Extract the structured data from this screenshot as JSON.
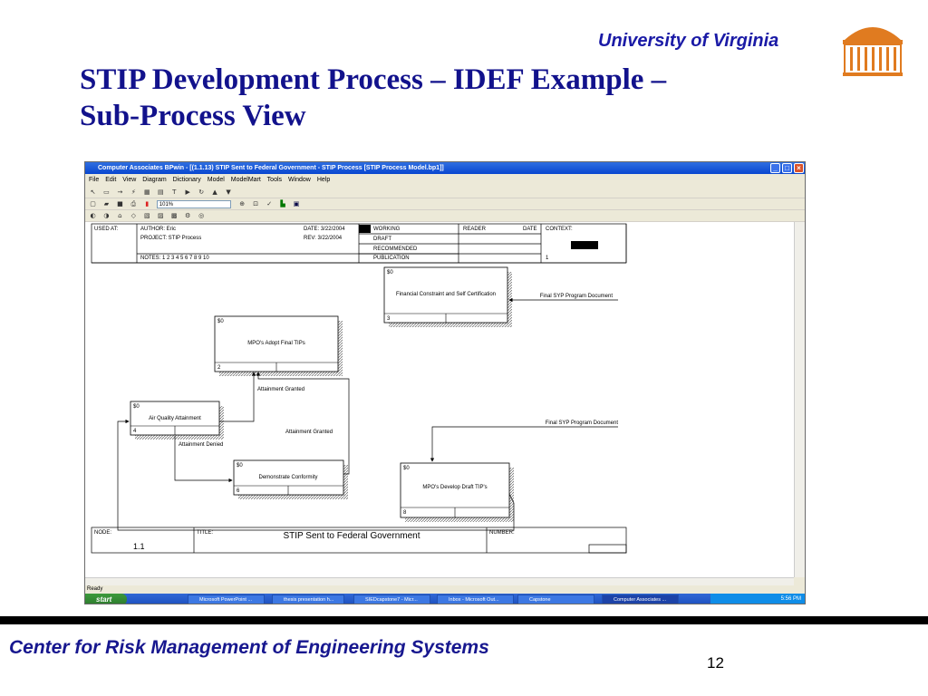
{
  "header": {
    "university": "University of Virginia",
    "title_line1": "STIP Development Process – IDEF Example –",
    "title_line2": "Sub-Process View",
    "logo_icon": "rotunda-logo-icon"
  },
  "footer": {
    "center": "Center for Risk Management of Engineering Systems",
    "page_number": "12"
  },
  "app": {
    "window_title": "Computer Associates BPwin - [(1.1.13) STIP Sent to Federal Government - STIP Process  [STIP Process Model.bp1]]",
    "menu": [
      "File",
      "Edit",
      "View",
      "Diagram",
      "Dictionary",
      "Model",
      "ModelMart",
      "Tools",
      "Window",
      "Help"
    ],
    "zoom": "101%",
    "status": "Ready"
  },
  "diagram": {
    "header": {
      "used_at": "USED AT:",
      "author": "AUTHOR:  Eric",
      "project": "PROJECT:  STIP Process",
      "notes": "NOTES:  1  2  3  4  5  6  7  8  9  10",
      "date": "DATE:  3/22/2004",
      "rev": "REV:    3/22/2004",
      "working": "WORKING",
      "draft": "DRAFT",
      "recommended": "RECOMMENDED",
      "publication": "PUBLICATION",
      "reader": "READER",
      "date2": "DATE",
      "context": "CONTEXT:",
      "context_num": "1"
    },
    "boxes": [
      {
        "cost": "$0",
        "label": "Financial Constraint and Self Certification",
        "num": "3"
      },
      {
        "cost": "$0",
        "label": "MPO's Adopt Final TIPs",
        "num": "2"
      },
      {
        "cost": "$0",
        "label": "Air Quality Attainment",
        "num": "4"
      },
      {
        "cost": "$0",
        "label": "Demonstrate Conformity",
        "num": "6"
      },
      {
        "cost": "$0",
        "label": "MPO's Develop Draft TIP's",
        "num": "8"
      }
    ],
    "arrows": {
      "final_syp_1": "Final SYP Program Document",
      "final_syp_2": "Final SYP Program Document",
      "attainment_granted_1": "Attainment Granted",
      "attainment_granted_2": "Attainment Granted",
      "attainment_denied": "Attainment Denied"
    },
    "footer": {
      "node_label": "NODE:",
      "node_value": "1.1",
      "title_label": "TITLE:",
      "title_value": "STIP Sent to Federal Government",
      "number_label": "NUMBER:"
    }
  },
  "taskbar": {
    "start": "start",
    "tasks": [
      "Microsoft PowerPoint ...",
      "thesis presentation h...",
      "SIEDcapstone7 - Micr...",
      "Inbox - Microsoft Out...",
      "Capstone",
      "Computer Associates ..."
    ],
    "time": "5:56 PM"
  }
}
